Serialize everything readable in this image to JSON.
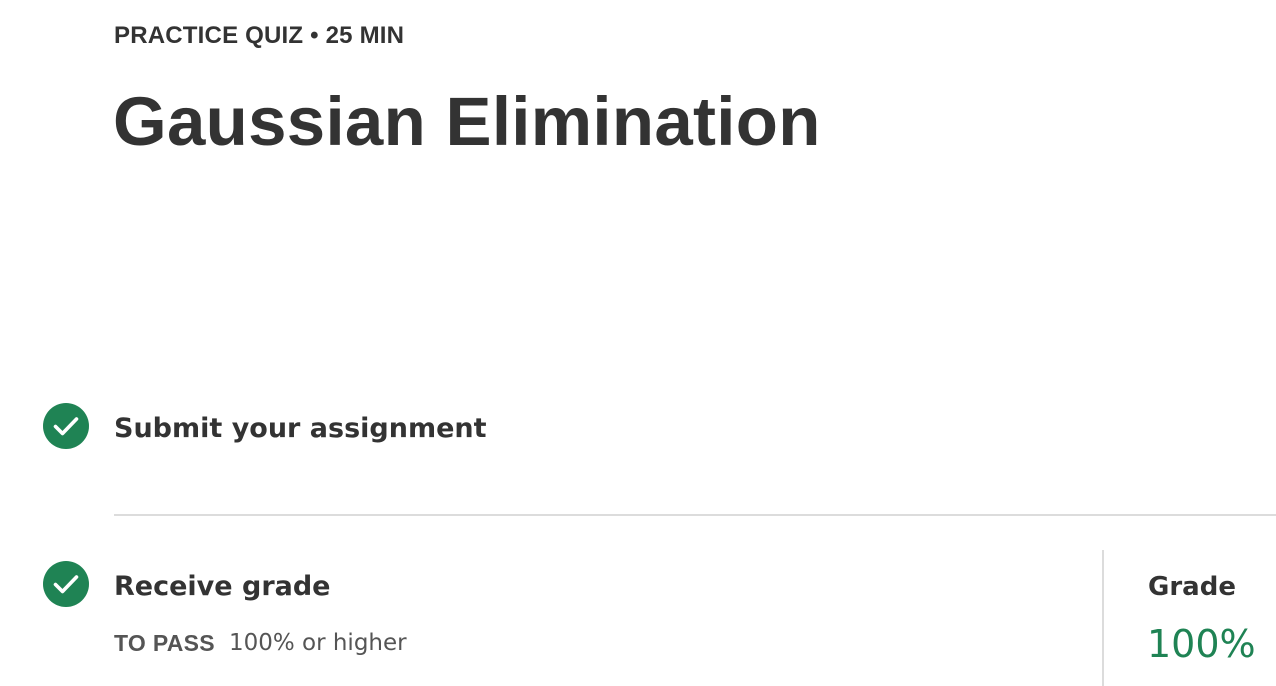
{
  "header": {
    "eyebrow": "PRACTICE QUIZ • 25 MIN",
    "title": "Gaussian Elimination"
  },
  "steps": {
    "submit": {
      "label": "Submit your assignment",
      "status_icon": "check-circle-icon",
      "completed": true
    },
    "receive_grade": {
      "label": "Receive grade",
      "status_icon": "check-circle-icon",
      "completed": true,
      "to_pass_label": "TO PASS",
      "to_pass_value": "100% or higher"
    }
  },
  "grade": {
    "label": "Grade",
    "value": "100%"
  },
  "colors": {
    "accent": "#1f8354",
    "text": "#333333",
    "muted_text": "#555555",
    "divider": "#dcdcdc"
  }
}
